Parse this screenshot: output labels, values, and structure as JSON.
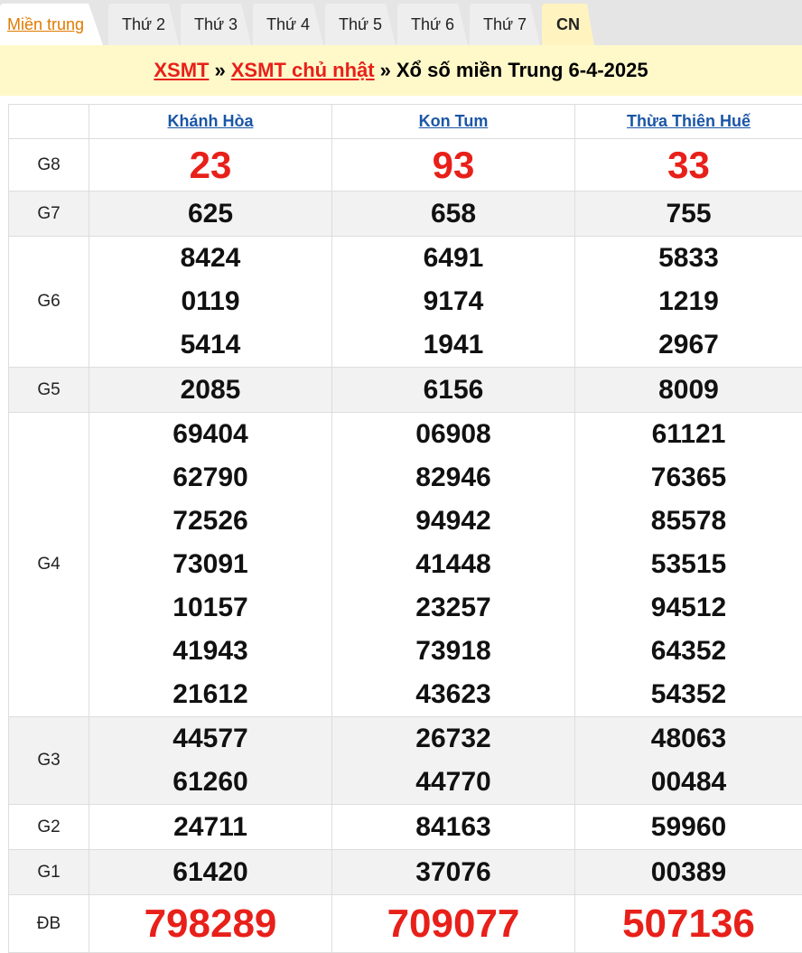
{
  "tabs": {
    "region": "Miền trung",
    "days": [
      "Thứ 2",
      "Thứ 3",
      "Thứ 4",
      "Thứ 5",
      "Thứ 6",
      "Thứ 7",
      "CN"
    ]
  },
  "breadcrumb": {
    "xsmt": "XSMT",
    "sep1": "»",
    "xsmt_sunday": "XSMT chủ nhật",
    "sep2": "»",
    "title": "Xổ số miền Trung 6-4-2025"
  },
  "provinces": [
    "Khánh Hòa",
    "Kon Tum",
    "Thừa Thiên Huế"
  ],
  "prizes": {
    "g8": {
      "label": "G8",
      "values": [
        [
          "23"
        ],
        [
          "93"
        ],
        [
          "33"
        ]
      ]
    },
    "g7": {
      "label": "G7",
      "values": [
        [
          "625"
        ],
        [
          "658"
        ],
        [
          "755"
        ]
      ]
    },
    "g6": {
      "label": "G6",
      "values": [
        [
          "8424",
          "0119",
          "5414"
        ],
        [
          "6491",
          "9174",
          "1941"
        ],
        [
          "5833",
          "1219",
          "2967"
        ]
      ]
    },
    "g5": {
      "label": "G5",
      "values": [
        [
          "2085"
        ],
        [
          "6156"
        ],
        [
          "8009"
        ]
      ]
    },
    "g4": {
      "label": "G4",
      "values": [
        [
          "69404",
          "62790",
          "72526",
          "73091",
          "10157",
          "41943",
          "21612"
        ],
        [
          "06908",
          "82946",
          "94942",
          "41448",
          "23257",
          "73918",
          "43623"
        ],
        [
          "61121",
          "76365",
          "85578",
          "53515",
          "94512",
          "64352",
          "54352"
        ]
      ]
    },
    "g3": {
      "label": "G3",
      "values": [
        [
          "44577",
          "61260"
        ],
        [
          "26732",
          "44770"
        ],
        [
          "48063",
          "00484"
        ]
      ]
    },
    "g2": {
      "label": "G2",
      "values": [
        [
          "24711"
        ],
        [
          "84163"
        ],
        [
          "59960"
        ]
      ]
    },
    "g1": {
      "label": "G1",
      "values": [
        [
          "61420"
        ],
        [
          "37076"
        ],
        [
          "00389"
        ]
      ]
    },
    "db": {
      "label": "ĐB",
      "values": [
        [
          "798289"
        ],
        [
          "709077"
        ],
        [
          "507136"
        ]
      ]
    }
  },
  "colors": {
    "accent_red": "#e8201a",
    "link_blue": "#1a56a6",
    "banner_yellow": "#fff9c9",
    "tab_orange": "#e07b00"
  }
}
